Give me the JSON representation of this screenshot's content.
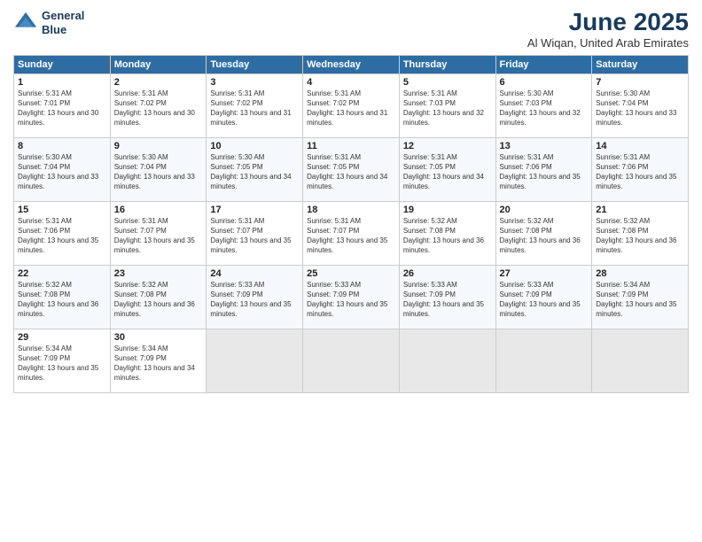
{
  "header": {
    "logo_line1": "General",
    "logo_line2": "Blue",
    "month_year": "June 2025",
    "location": "Al Wiqan, United Arab Emirates"
  },
  "days_of_week": [
    "Sunday",
    "Monday",
    "Tuesday",
    "Wednesday",
    "Thursday",
    "Friday",
    "Saturday"
  ],
  "weeks": [
    [
      {
        "day": 1,
        "sunrise": "5:31 AM",
        "sunset": "7:01 PM",
        "daylight": "13 hours and 30 minutes."
      },
      {
        "day": 2,
        "sunrise": "5:31 AM",
        "sunset": "7:02 PM",
        "daylight": "13 hours and 30 minutes."
      },
      {
        "day": 3,
        "sunrise": "5:31 AM",
        "sunset": "7:02 PM",
        "daylight": "13 hours and 31 minutes."
      },
      {
        "day": 4,
        "sunrise": "5:31 AM",
        "sunset": "7:02 PM",
        "daylight": "13 hours and 31 minutes."
      },
      {
        "day": 5,
        "sunrise": "5:31 AM",
        "sunset": "7:03 PM",
        "daylight": "13 hours and 32 minutes."
      },
      {
        "day": 6,
        "sunrise": "5:30 AM",
        "sunset": "7:03 PM",
        "daylight": "13 hours and 32 minutes."
      },
      {
        "day": 7,
        "sunrise": "5:30 AM",
        "sunset": "7:04 PM",
        "daylight": "13 hours and 33 minutes."
      }
    ],
    [
      {
        "day": 8,
        "sunrise": "5:30 AM",
        "sunset": "7:04 PM",
        "daylight": "13 hours and 33 minutes."
      },
      {
        "day": 9,
        "sunrise": "5:30 AM",
        "sunset": "7:04 PM",
        "daylight": "13 hours and 33 minutes."
      },
      {
        "day": 10,
        "sunrise": "5:30 AM",
        "sunset": "7:05 PM",
        "daylight": "13 hours and 34 minutes."
      },
      {
        "day": 11,
        "sunrise": "5:31 AM",
        "sunset": "7:05 PM",
        "daylight": "13 hours and 34 minutes."
      },
      {
        "day": 12,
        "sunrise": "5:31 AM",
        "sunset": "7:05 PM",
        "daylight": "13 hours and 34 minutes."
      },
      {
        "day": 13,
        "sunrise": "5:31 AM",
        "sunset": "7:06 PM",
        "daylight": "13 hours and 35 minutes."
      },
      {
        "day": 14,
        "sunrise": "5:31 AM",
        "sunset": "7:06 PM",
        "daylight": "13 hours and 35 minutes."
      }
    ],
    [
      {
        "day": 15,
        "sunrise": "5:31 AM",
        "sunset": "7:06 PM",
        "daylight": "13 hours and 35 minutes."
      },
      {
        "day": 16,
        "sunrise": "5:31 AM",
        "sunset": "7:07 PM",
        "daylight": "13 hours and 35 minutes."
      },
      {
        "day": 17,
        "sunrise": "5:31 AM",
        "sunset": "7:07 PM",
        "daylight": "13 hours and 35 minutes."
      },
      {
        "day": 18,
        "sunrise": "5:31 AM",
        "sunset": "7:07 PM",
        "daylight": "13 hours and 35 minutes."
      },
      {
        "day": 19,
        "sunrise": "5:32 AM",
        "sunset": "7:08 PM",
        "daylight": "13 hours and 36 minutes."
      },
      {
        "day": 20,
        "sunrise": "5:32 AM",
        "sunset": "7:08 PM",
        "daylight": "13 hours and 36 minutes."
      },
      {
        "day": 21,
        "sunrise": "5:32 AM",
        "sunset": "7:08 PM",
        "daylight": "13 hours and 36 minutes."
      }
    ],
    [
      {
        "day": 22,
        "sunrise": "5:32 AM",
        "sunset": "7:08 PM",
        "daylight": "13 hours and 36 minutes."
      },
      {
        "day": 23,
        "sunrise": "5:32 AM",
        "sunset": "7:08 PM",
        "daylight": "13 hours and 36 minutes."
      },
      {
        "day": 24,
        "sunrise": "5:33 AM",
        "sunset": "7:09 PM",
        "daylight": "13 hours and 35 minutes."
      },
      {
        "day": 25,
        "sunrise": "5:33 AM",
        "sunset": "7:09 PM",
        "daylight": "13 hours and 35 minutes."
      },
      {
        "day": 26,
        "sunrise": "5:33 AM",
        "sunset": "7:09 PM",
        "daylight": "13 hours and 35 minutes."
      },
      {
        "day": 27,
        "sunrise": "5:33 AM",
        "sunset": "7:09 PM",
        "daylight": "13 hours and 35 minutes."
      },
      {
        "day": 28,
        "sunrise": "5:34 AM",
        "sunset": "7:09 PM",
        "daylight": "13 hours and 35 minutes."
      }
    ],
    [
      {
        "day": 29,
        "sunrise": "5:34 AM",
        "sunset": "7:09 PM",
        "daylight": "13 hours and 35 minutes."
      },
      {
        "day": 30,
        "sunrise": "5:34 AM",
        "sunset": "7:09 PM",
        "daylight": "13 hours and 34 minutes."
      },
      null,
      null,
      null,
      null,
      null
    ]
  ]
}
